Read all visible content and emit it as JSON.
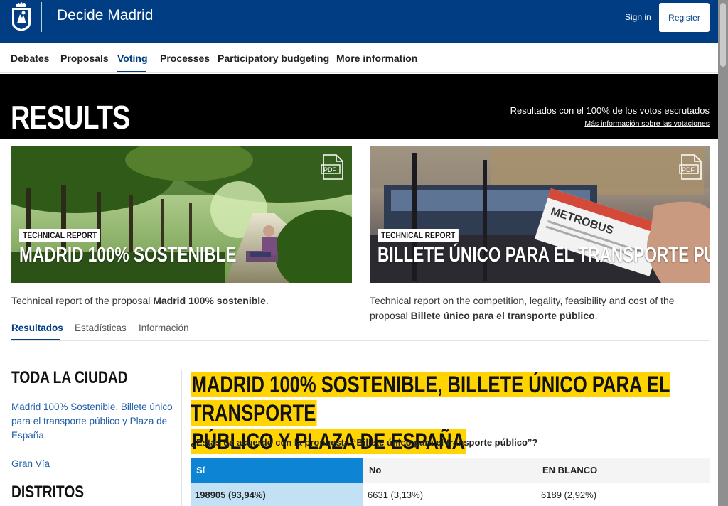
{
  "header": {
    "brand": "Decide Madrid",
    "sign_in": "Sign in",
    "register": "Register"
  },
  "nav": {
    "items": [
      "Debates",
      "Proposals",
      "Voting",
      "Processes",
      "Participatory budgeting",
      "More information"
    ],
    "active": "Voting"
  },
  "banner": {
    "title": "RESULTS",
    "status": "Resultados con el 100% de los votos escrutados",
    "link": "Más información sobre las votaciones"
  },
  "cards": [
    {
      "badge": "TECHNICAL REPORT",
      "title": "MADRID 100% SOSTENIBLE",
      "desc_prefix": "Technical report of the proposal ",
      "desc_bold": "Madrid 100% sostenible",
      "desc_suffix": ".",
      "icon": "pdf-icon"
    },
    {
      "badge": "TECHNICAL REPORT",
      "title": "BILLETE ÚNICO PARA EL TRANSPORTE PÚBLICO",
      "desc_prefix": "Technical report on the competition, legality, feasibility and cost of the proposal ",
      "desc_bold": "Billete único para el transporte público",
      "desc_suffix": ".",
      "icon": "pdf-icon"
    }
  ],
  "tabs": [
    "Resultados",
    "Estadísticas",
    "Información"
  ],
  "active_tab": "Resultados",
  "sidebar": {
    "heading_city": "TODA LA CIUDAD",
    "city_link": "Madrid 100% Sostenible, Billete único para el transporte público y Plaza de España",
    "gran_via": "Gran Vía",
    "heading_districts": "DISTRITOS"
  },
  "main": {
    "title_line1": "MADRID 100% SOSTENIBLE, BILLETE ÚNICO PARA EL TRANSPORTE",
    "title_line2": "PÚBLICO Y PLAZA DE ESPAÑA",
    "question": "¿Estás de acuerdo con la propuesta “Billete único para el transporte público”?",
    "columns": [
      "Sí",
      "No",
      "EN BLANCO"
    ],
    "values": [
      "198905 (93,94%)",
      "6631 (3,13%)",
      "6189 (2,92%)"
    ],
    "winner_color": "#0d84d4"
  },
  "colors": {
    "header_blue": "#003d82",
    "highlight_yellow": "#ffd400",
    "link_blue": "#1f5fa8"
  }
}
